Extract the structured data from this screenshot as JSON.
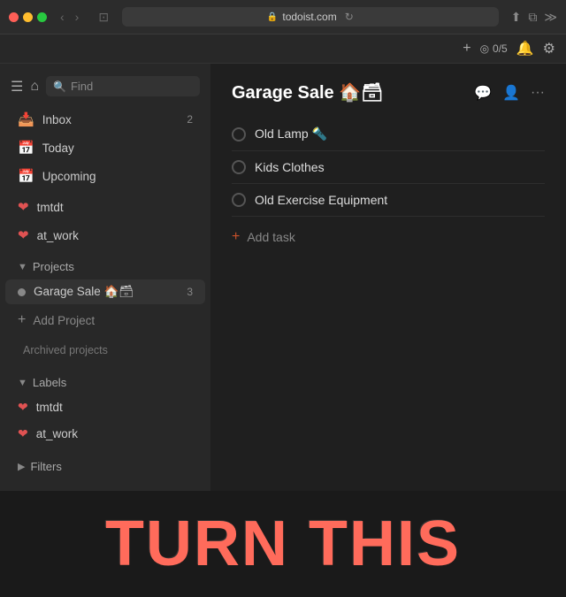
{
  "browser": {
    "url": "todoist.com",
    "back_btn": "‹",
    "forward_btn": "›",
    "window_btn": "⊡",
    "lock_icon": "🔒",
    "reload_icon": "↻",
    "share_icon": "⬆",
    "tab_icon": "⧉",
    "overflow_icon": "≫"
  },
  "toolbar": {
    "add_icon": "+",
    "karma_icon": "◎",
    "karma_value": "0/5",
    "notifications_icon": "🔔",
    "settings_icon": "⚙"
  },
  "sidebar": {
    "hamburger": "☰",
    "home": "⌂",
    "search_placeholder": "Find",
    "nav_items": [
      {
        "id": "inbox",
        "icon": "📥",
        "label": "Inbox",
        "badge": "2"
      },
      {
        "id": "today",
        "icon": "📅",
        "label": "Today",
        "badge": ""
      },
      {
        "id": "upcoming",
        "icon": "📅",
        "label": "Upcoming",
        "badge": ""
      }
    ],
    "personal_labels": [
      {
        "id": "tmtdt",
        "icon": "❤",
        "label": "tmtdt",
        "color": "#e05252"
      },
      {
        "id": "at_work",
        "icon": "❤",
        "label": "at_work",
        "color": "#e05252"
      }
    ],
    "projects_section": "Projects",
    "projects": [
      {
        "id": "garage-sale",
        "label": "Garage Sale 🏠🗃",
        "count": "3"
      }
    ],
    "add_project_label": "Add Project",
    "archived_label": "Archived projects",
    "labels_section": "Labels",
    "label_items": [
      {
        "id": "tmtdt-lbl",
        "icon": "❤",
        "label": "tmtdt",
        "color": "#e05252"
      },
      {
        "id": "at_work-lbl",
        "icon": "❤",
        "label": "at_work",
        "color": "#e05252"
      }
    ],
    "filters_section": "Filters"
  },
  "main": {
    "project_title": "Garage Sale 🏠🗃",
    "comment_icon": "💬",
    "share_icon": "👤",
    "more_icon": "···",
    "tasks": [
      {
        "id": "task-1",
        "text": "Old Lamp 🔦"
      },
      {
        "id": "task-2",
        "text": "Kids Clothes"
      },
      {
        "id": "task-3",
        "text": "Old Exercise Equipment"
      }
    ],
    "add_task_label": "Add task"
  },
  "overlay": {
    "text": "TURN THIS"
  }
}
